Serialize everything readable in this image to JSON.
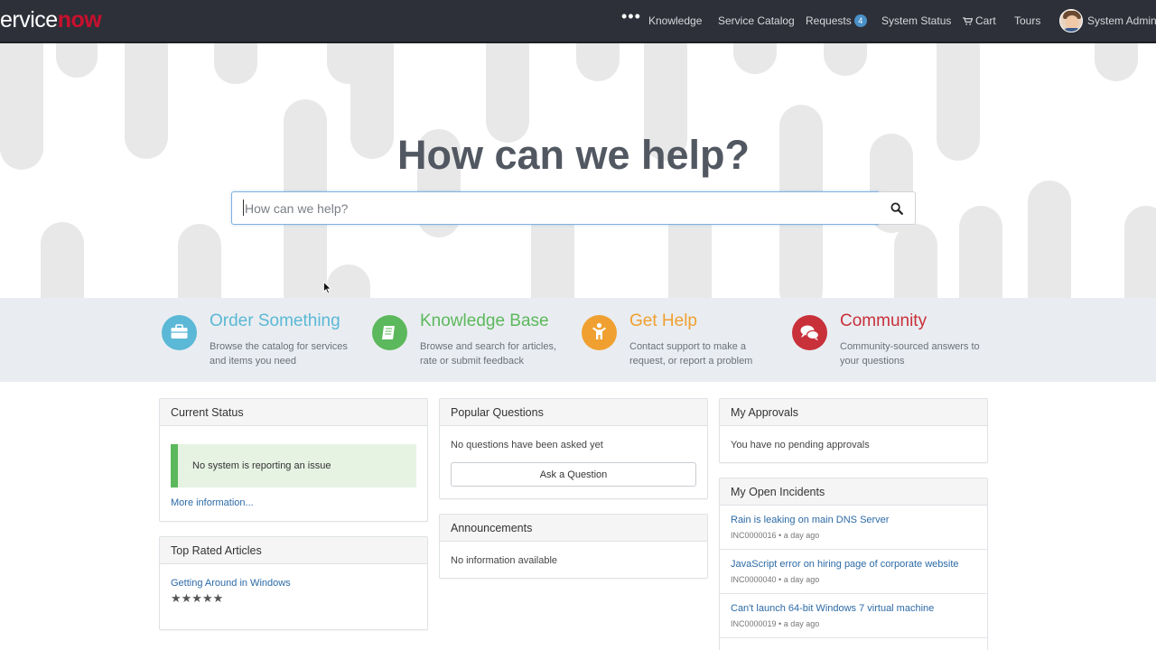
{
  "brand": {
    "logo_part1": "ervice",
    "logo_part2": "now"
  },
  "header": {
    "more": "•••",
    "nav": [
      "Knowledge",
      "Service Catalog",
      "Requests",
      "System Status",
      "Cart",
      "Tours"
    ],
    "requests_count": "4",
    "user_name": "System Administrator"
  },
  "hero": {
    "title": "How can we help?",
    "search_placeholder": "How can we help?"
  },
  "features": [
    {
      "title": "Order Something",
      "desc": "Browse the catalog for services and items you need",
      "color": "#5bb8d6",
      "icon": "briefcase-icon"
    },
    {
      "title": "Knowledge Base",
      "desc": "Browse and search for articles, rate or submit feedback",
      "color": "#5cb85c",
      "icon": "book-icon"
    },
    {
      "title": "Get Help",
      "desc": "Contact support to make a request, or report a problem",
      "color": "#f0a030",
      "icon": "person-help-icon"
    },
    {
      "title": "Community",
      "desc": "Community-sourced answers to your questions",
      "color": "#c8303a",
      "icon": "chat-bubbles-icon"
    }
  ],
  "current_status": {
    "title": "Current Status",
    "message": "No system is reporting an issue",
    "more_link": "More information..."
  },
  "top_rated": {
    "title": "Top Rated Articles",
    "article": "Getting Around in Windows",
    "stars": "★★★★★",
    "rating": 5
  },
  "popular_questions": {
    "title": "Popular Questions",
    "message": "No questions have been asked yet",
    "button": "Ask a Question"
  },
  "announcements": {
    "title": "Announcements",
    "message": "No information available"
  },
  "approvals": {
    "title": "My Approvals",
    "message": "You have no pending approvals"
  },
  "incidents": {
    "title": "My Open Incidents",
    "items": [
      {
        "title": "Rain is leaking on main DNS Server",
        "meta": "INC0000016 • a day ago"
      },
      {
        "title": "JavaScript error on hiring page of corporate website",
        "meta": "INC0000040 • a day ago"
      },
      {
        "title": "Can't launch 64-bit Windows 7 virtual machine",
        "meta": "INC0000019 • a day ago"
      }
    ]
  },
  "colors": {
    "nav_bg": "#2d3038",
    "brand_red": "#c8102e",
    "link": "#2c6aa6",
    "band_bg": "#e9edf1"
  }
}
